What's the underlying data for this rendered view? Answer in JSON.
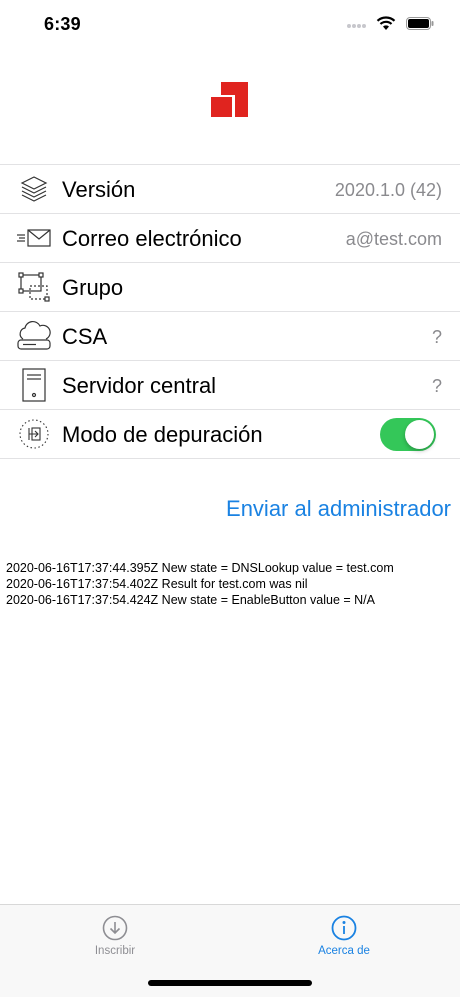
{
  "status_bar": {
    "time": "6:39"
  },
  "rows": [
    {
      "label": "Versión",
      "value": "2020.1.0 (42)",
      "icon": "layers-icon"
    },
    {
      "label": "Correo electrónico",
      "value": "a@test.com",
      "icon": "envelope-icon"
    },
    {
      "label": "Grupo",
      "value": "",
      "icon": "group-icon"
    },
    {
      "label": "CSA",
      "value": "?",
      "icon": "cloud-server-icon"
    },
    {
      "label": "Servidor central",
      "value": "?",
      "icon": "server-icon"
    },
    {
      "label": "Modo de depuración",
      "icon": "debug-icon",
      "toggle_on": true
    }
  ],
  "send_link": "Enviar al administrador",
  "log_lines": [
    "2020-06-16T17:37:44.395Z New state = DNSLookup value = test.com",
    "2020-06-16T17:37:54.402Z Result for test.com was nil",
    "2020-06-16T17:37:54.424Z New state = EnableButton value = N/A"
  ],
  "tabs": [
    {
      "label": "Inscribir",
      "active": false,
      "icon": "download-circle-icon"
    },
    {
      "label": "Acerca de",
      "active": true,
      "icon": "info-circle-icon"
    }
  ],
  "colors": {
    "accent": "#1a82e2",
    "toggle_on": "#34c759",
    "logo_red": "#e0241f",
    "inactive_tab": "#8e8e93"
  }
}
